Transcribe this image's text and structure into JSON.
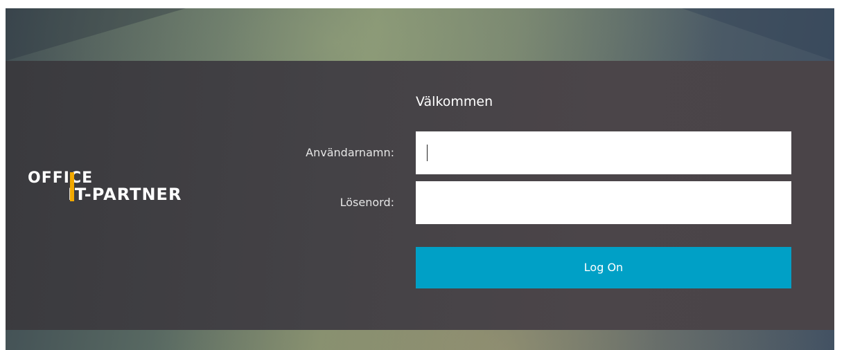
{
  "brand": {
    "logo_line1": "OFFICE",
    "logo_line2": "IT-PARTNER",
    "accent_color": "#f2a900"
  },
  "login": {
    "title": "Välkommen",
    "username_label": "Användarnamn:",
    "username_value": "",
    "password_label": "Lösenord:",
    "password_value": "",
    "submit_label": "Log On",
    "button_color": "#00a0c6"
  }
}
